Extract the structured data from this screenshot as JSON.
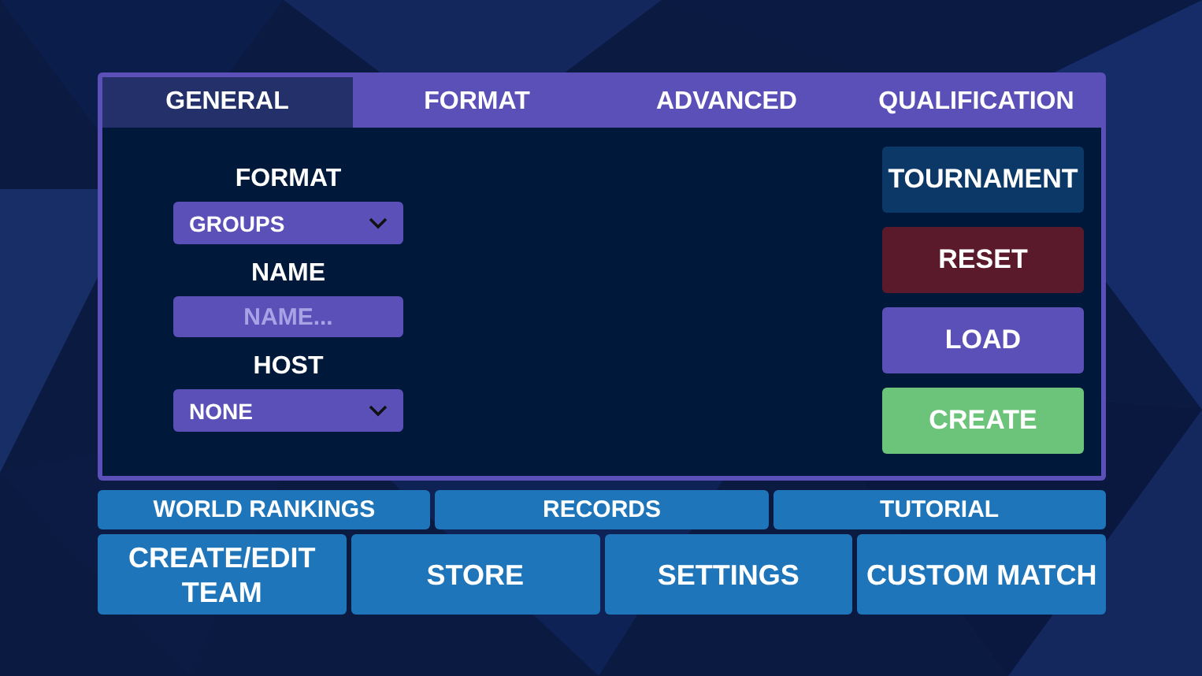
{
  "tabs": [
    {
      "label": "GENERAL",
      "selected": true
    },
    {
      "label": "FORMAT",
      "selected": false
    },
    {
      "label": "ADVANCED",
      "selected": false
    },
    {
      "label": "QUALIFICATION",
      "selected": false
    }
  ],
  "form": [
    {
      "label": "FORMAT",
      "kind": "select",
      "value": "GROUPS"
    },
    {
      "label": "NAME",
      "kind": "text",
      "placeholder": "NAME..."
    },
    {
      "label": "HOST",
      "kind": "select",
      "value": "NONE"
    }
  ],
  "actions": [
    {
      "label": "TOURNAMENT",
      "kind": "mode"
    },
    {
      "label": "RESET",
      "kind": "danger"
    },
    {
      "label": "LOAD",
      "kind": "normal"
    },
    {
      "label": "CREATE",
      "kind": "confirm"
    }
  ],
  "menu_top": [
    "WORLD RANKINGS",
    "RECORDS",
    "TUTORIAL"
  ],
  "menu_bottom": [
    "CREATE/EDIT TEAM",
    "STORE",
    "SETTINGS",
    "CUSTOM MATCH"
  ]
}
